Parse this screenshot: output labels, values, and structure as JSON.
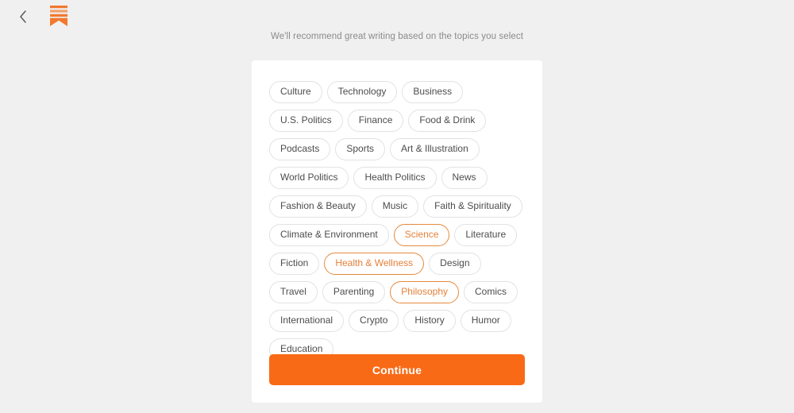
{
  "header": {
    "back_icon": "chevron-left-icon",
    "logo_icon": "bookmark-logo-icon",
    "brand_color": "#f2792e"
  },
  "subtitle": "We'll recommend great writing based on the topics you select",
  "topics": [
    {
      "label": "Culture",
      "selected": false
    },
    {
      "label": "Technology",
      "selected": false
    },
    {
      "label": "Business",
      "selected": false
    },
    {
      "label": "U.S. Politics",
      "selected": false
    },
    {
      "label": "Finance",
      "selected": false
    },
    {
      "label": "Food & Drink",
      "selected": false
    },
    {
      "label": "Podcasts",
      "selected": false
    },
    {
      "label": "Sports",
      "selected": false
    },
    {
      "label": "Art & Illustration",
      "selected": false
    },
    {
      "label": "World Politics",
      "selected": false
    },
    {
      "label": "Health Politics",
      "selected": false
    },
    {
      "label": "News",
      "selected": false
    },
    {
      "label": "Fashion & Beauty",
      "selected": false
    },
    {
      "label": "Music",
      "selected": false
    },
    {
      "label": "Faith & Spirituality",
      "selected": false
    },
    {
      "label": "Climate & Environment",
      "selected": false
    },
    {
      "label": "Science",
      "selected": true
    },
    {
      "label": "Literature",
      "selected": false
    },
    {
      "label": "Fiction",
      "selected": false
    },
    {
      "label": "Health & Wellness",
      "selected": true
    },
    {
      "label": "Design",
      "selected": false
    },
    {
      "label": "Travel",
      "selected": false
    },
    {
      "label": "Parenting",
      "selected": false
    },
    {
      "label": "Philosophy",
      "selected": true
    },
    {
      "label": "Comics",
      "selected": false
    },
    {
      "label": "International",
      "selected": false
    },
    {
      "label": "Crypto",
      "selected": false
    },
    {
      "label": "History",
      "selected": false
    },
    {
      "label": "Humor",
      "selected": false
    },
    {
      "label": "Education",
      "selected": false
    }
  ],
  "footer": {
    "continue_label": "Continue",
    "continue_color": "#f96a16"
  },
  "colors": {
    "page_background": "#f0f0f0",
    "card_background": "#ffffff",
    "tag_border": "#e2e2e2",
    "tag_text": "#4c4c4c",
    "tag_selected_border": "#e78a3c",
    "tag_selected_text": "#e4803a",
    "subtitle_text": "#8a8a8a"
  }
}
